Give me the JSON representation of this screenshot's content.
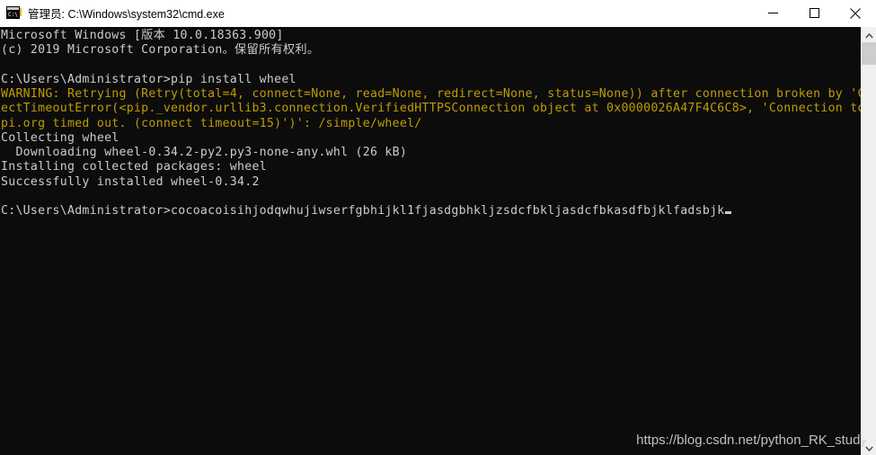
{
  "window": {
    "title": "管理员: C:\\Windows\\system32\\cmd.exe",
    "icon": "cmd-icon",
    "background_color": "#0c0c0c",
    "titlebar_color": "#ffffff"
  },
  "controls": {
    "minimize_label": "最小化",
    "maximize_label": "最大化",
    "close_label": "关闭"
  },
  "console": {
    "text_color": "#cccccc",
    "warning_color": "#c19c00",
    "lines": [
      {
        "text": "Microsoft Windows [版本 10.0.18363.900]",
        "style": "normal"
      },
      {
        "text": "(c) 2019 Microsoft Corporation。保留所有权利。",
        "style": "normal"
      },
      {
        "text": "",
        "style": "normal"
      },
      {
        "text": "C:\\Users\\Administrator>pip install wheel",
        "style": "normal"
      },
      {
        "text": "WARNING: Retrying (Retry(total=4, connect=None, read=None, redirect=None, status=None)) after connection broken by 'Conn",
        "style": "warning"
      },
      {
        "text": "ectTimeoutError(<pip._vendor.urllib3.connection.VerifiedHTTPSConnection object at 0x0000026A47F4C6C8>, 'Connection to py",
        "style": "warning"
      },
      {
        "text": "pi.org timed out. (connect timeout=15)')': /simple/wheel/",
        "style": "warning"
      },
      {
        "text": "Collecting wheel",
        "style": "normal"
      },
      {
        "text": "  Downloading wheel-0.34.2-py2.py3-none-any.whl (26 kB)",
        "style": "normal"
      },
      {
        "text": "Installing collected packages: wheel",
        "style": "normal"
      },
      {
        "text": "Successfully installed wheel-0.34.2",
        "style": "normal"
      },
      {
        "text": "",
        "style": "normal"
      },
      {
        "text": "C:\\Users\\Administrator>cocoacoisihjodqwhujiwserfgbhijkl1fjasdgbhkljzsdcfbkljasdcfbkasdfbjklfadsbjk",
        "style": "prompt-cursor"
      }
    ]
  },
  "scrollbar": {
    "up_arrow": "chevron-up-icon",
    "down_arrow": "chevron-down-icon",
    "thumb_position_percent": 0
  },
  "watermark": {
    "text": "https://blog.csdn.net/python_RK_study"
  }
}
